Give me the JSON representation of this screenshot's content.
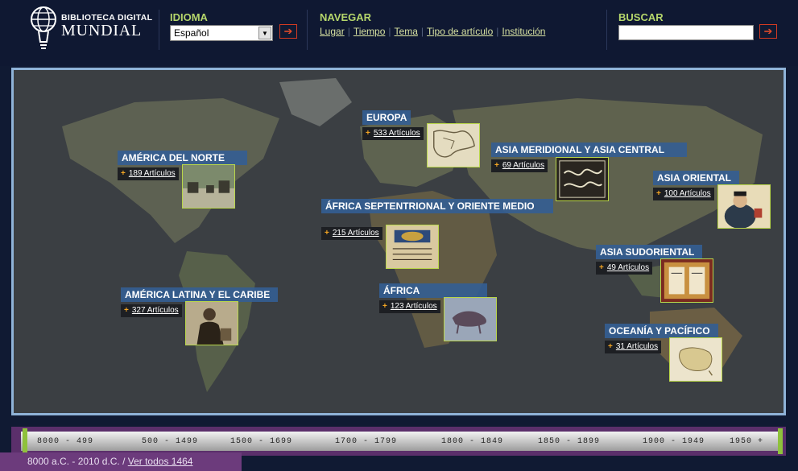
{
  "logo": {
    "line1": "BIBLIOTECA DIGITAL",
    "line2": "MUNDIAL",
    "icon": "lightbulb-globe-icon"
  },
  "header": {
    "language": {
      "label": "IDIOMA",
      "selected": "Español"
    },
    "navigate": {
      "label": "NAVEGAR",
      "links": [
        "Lugar",
        "Tiempo",
        "Tema",
        "Tipo de artículo",
        "Institución"
      ]
    },
    "search": {
      "label": "BUSCAR",
      "value": "",
      "placeholder": ""
    },
    "go_glyph": "➔"
  },
  "regions": [
    {
      "name": "EUROPA",
      "count": "533 Artículos"
    },
    {
      "name": "AMÉRICA DEL NORTE",
      "count": "189 Artículos"
    },
    {
      "name": "ASIA MERIDIONAL Y ASIA CENTRAL",
      "count": "69 Artículos"
    },
    {
      "name": "ASIA ORIENTAL",
      "count": "100 Artículos"
    },
    {
      "name": "ÁFRICA SEPTENTRIONAL Y ORIENTE MEDIO",
      "count": "215 Artículos"
    },
    {
      "name": "ASIA SUDORIENTAL",
      "count": "49 Artículos"
    },
    {
      "name": "AMÉRICA LATINA Y EL CARIBE",
      "count": "327 Artículos"
    },
    {
      "name": "ÁFRICA",
      "count": "123 Artículos"
    },
    {
      "name": "OCEANÍA Y PACÍFICO",
      "count": "31 Artículos"
    }
  ],
  "timeline": {
    "segments": [
      "8000 - 499",
      "500 - 1499",
      "1500 - 1699",
      "1700 - 1799",
      "1800 - 1849",
      "1850 - 1899",
      "1900 - 1949",
      "1950 +"
    ],
    "range_text": "8000 a.C. - 2010 d.C. / ",
    "view_all": "Ver todos 1464"
  },
  "colors": {
    "accent_green": "#b5d66b",
    "region_blue": "#345e94",
    "timeline_purple": "#5b2f6b",
    "go_red": "#d23a22"
  }
}
